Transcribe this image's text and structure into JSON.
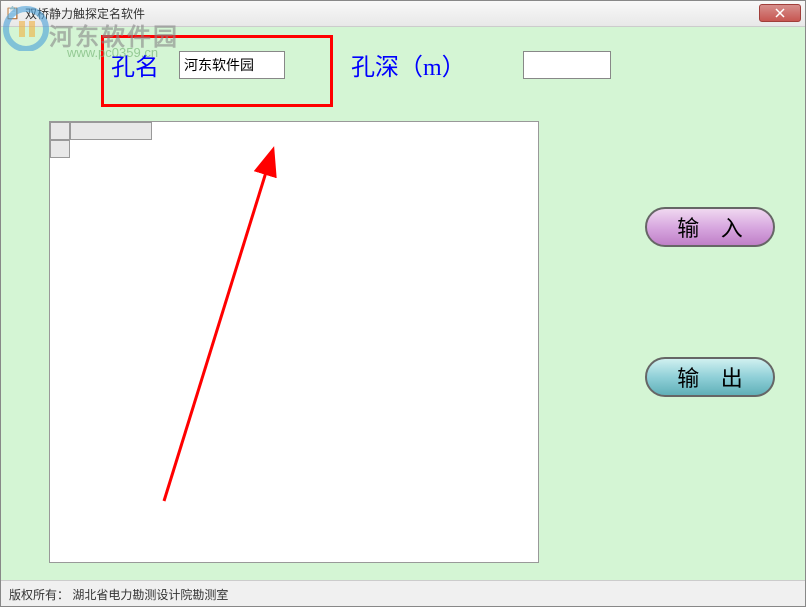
{
  "window": {
    "title": "双桥静力触探定名软件"
  },
  "fields": {
    "hole_name_label": "孔名",
    "hole_name_value": "河东软件园",
    "hole_depth_label": "孔深（m）",
    "hole_depth_value": ""
  },
  "buttons": {
    "input_label": "输 入",
    "output_label": "输 出",
    "close_label": "×"
  },
  "footer": {
    "copyright": "版权所有：  湖北省电力勘测设计院勘测室"
  },
  "watermark": {
    "text": "河东软件园",
    "url": "www.pc0359.cn"
  },
  "colors": {
    "content_bg": "#d4f5d4",
    "label_color": "#0000ff",
    "highlight": "#ff0000"
  }
}
